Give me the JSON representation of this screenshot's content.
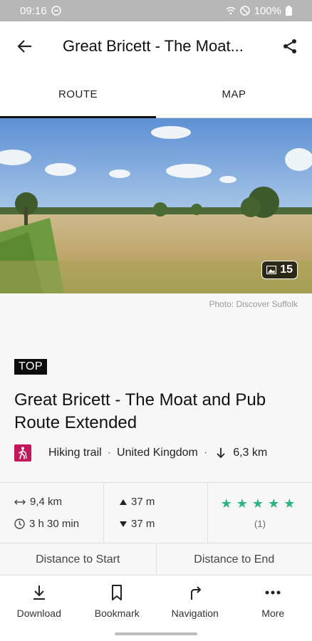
{
  "status_bar": {
    "time": "09:16",
    "battery": "100%"
  },
  "app_bar": {
    "title": "Great Bricett - The Moat..."
  },
  "tabs": [
    {
      "label": "ROUTE",
      "active": true
    },
    {
      "label": "MAP",
      "active": false
    }
  ],
  "hero": {
    "photo_count": "15",
    "credit": "Photo: Discover Suffolk"
  },
  "route": {
    "badge": "TOP",
    "title": "Great Bricett - The Moat and Pub Route Extended",
    "type": "Hiking trail",
    "country": "United Kingdom",
    "separator": "·",
    "descent_distance": "6,3 km"
  },
  "stats": {
    "distance": "9,4 km",
    "duration": "3 h 30 min",
    "ascent": "37 m",
    "descent": "37 m",
    "stars": "★★★★★",
    "rating_count": "(1)"
  },
  "distances": {
    "to_start": "Distance to Start",
    "to_end": "Distance to End"
  },
  "actions": [
    {
      "label": "Download",
      "icon": "download-icon"
    },
    {
      "label": "Bookmark",
      "icon": "bookmark-icon"
    },
    {
      "label": "Navigation",
      "icon": "navigation-icon"
    },
    {
      "label": "More",
      "icon": "more-icon"
    }
  ],
  "colors": {
    "accent_star": "#2bb57a",
    "hike_badge": "#c2185b",
    "top_badge": "#0d0d0d"
  }
}
